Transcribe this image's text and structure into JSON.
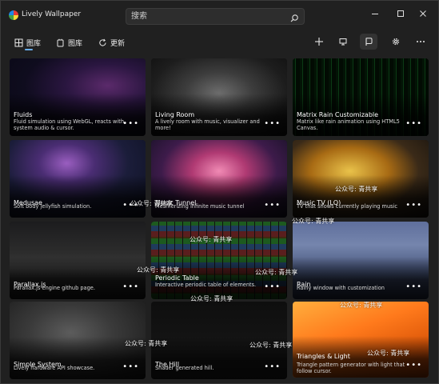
{
  "app": {
    "title": "Lively Wallpaper"
  },
  "search": {
    "placeholder": "搜索"
  },
  "tabs": [
    {
      "label": "图库",
      "icon": "grid-icon",
      "selected": true
    },
    {
      "label": "图库",
      "icon": "library-icon",
      "selected": false
    },
    {
      "label": "更新",
      "icon": "refresh-icon",
      "selected": false
    }
  ],
  "toolbar_actions": [
    {
      "name": "add-button",
      "icon": "plus-icon"
    },
    {
      "name": "screen-button",
      "icon": "monitor-icon"
    },
    {
      "name": "control-panel-button",
      "icon": "panel-icon",
      "active": true
    },
    {
      "name": "settings-button",
      "icon": "gear-icon"
    },
    {
      "name": "more-button",
      "icon": "more-icon"
    }
  ],
  "wallpapers": [
    {
      "title": "Fluids",
      "description": "Fluid simulation using WebGL, reacts with system audio & cursor."
    },
    {
      "title": "Living Room",
      "description": "A lively room with music, visualizer and more!"
    },
    {
      "title": "Matrix Rain Customizable",
      "description": "Matrix like rain animation using HTML5 Canvas."
    },
    {
      "title": "Medusae",
      "description": "Soft body jellyfish simulation."
    },
    {
      "title": "Music Tunnel",
      "description": "Mesmerizing infinite music tunnel"
    },
    {
      "title": "Music TV (LQ)",
      "description": "TV that shows currently playing music"
    },
    {
      "title": "Parallax.js",
      "description": "Parallax.js engine github page."
    },
    {
      "title": "Periodic Table",
      "description": "Interactive periodic table of elements."
    },
    {
      "title": "Rain",
      "description": "Rainy window with customization"
    },
    {
      "title": "Simple System",
      "description": "Lively hardware API showcase."
    },
    {
      "title": "The Hill",
      "description": "Shader generated hill."
    },
    {
      "title": "Triangles & Light",
      "description": "Triangle pattern generator with light that follow cursor."
    }
  ],
  "more_label": "•••",
  "watermark": "公众号: 青共享",
  "colors": {
    "accent": "#6ab0f3",
    "window_bg": "#202020"
  }
}
